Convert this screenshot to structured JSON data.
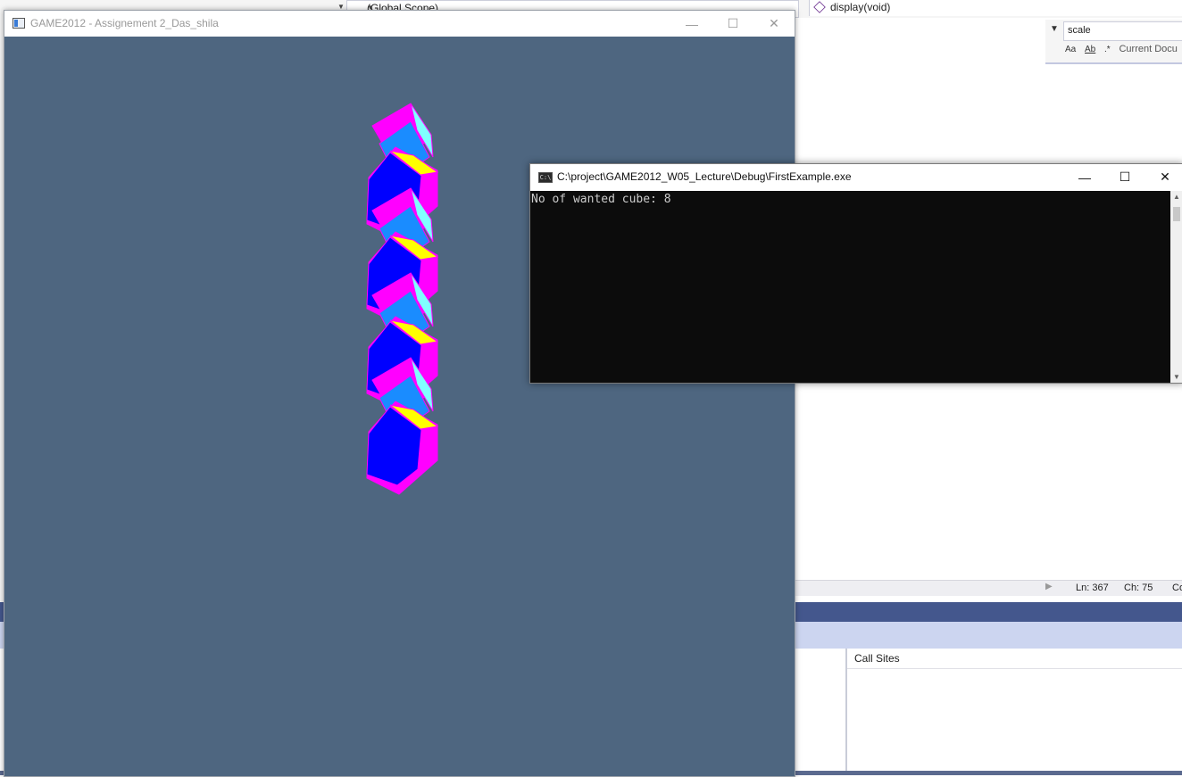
{
  "vs": {
    "scope_left": "(Global Scope)",
    "scope_right": "display(void)",
    "find_text": "scale",
    "find_option_case": "Aa",
    "find_option_word": "Ab",
    "find_option_regex": ".*",
    "find_scope": "Current Docu",
    "status_ln": "Ln: 367",
    "status_ch": "Ch: 75",
    "status_col": "Co",
    "call_sites": "Call Sites"
  },
  "gl_window": {
    "title": "GAME2012 - Assignement 2_Das_shila",
    "bg_color": "#4e6680",
    "cube_count": 8,
    "colors": [
      "#ff00ff",
      "#0000ff",
      "#1a8cff",
      "#ffff00",
      "#80ffff"
    ]
  },
  "console": {
    "title": "C:\\project\\GAME2012_W05_Lecture\\Debug\\FirstExample.exe",
    "icon_text": "C:\\",
    "output": "No of wanted cube: 8"
  },
  "window_controls": {
    "minimize": "—",
    "maximize": "☐",
    "close": "✕"
  }
}
